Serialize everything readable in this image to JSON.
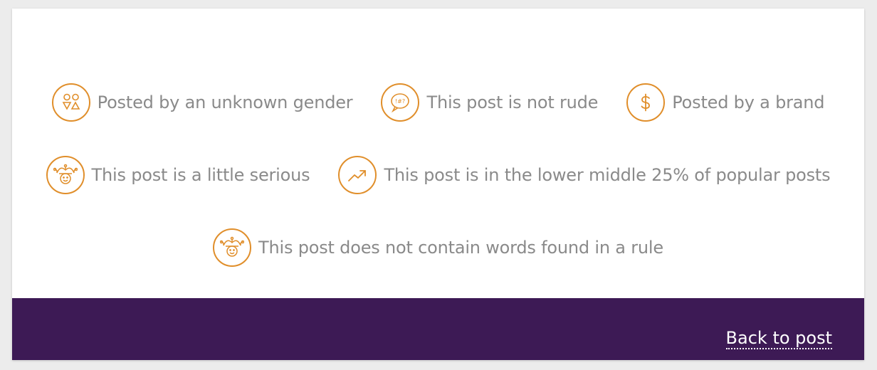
{
  "badges": {
    "gender": {
      "label": "Posted by an unknown gender",
      "icon": "gender-icon"
    },
    "rude": {
      "label": "This post is not rude",
      "icon": "speech-bubble-icon"
    },
    "brand": {
      "label": "Posted by a brand",
      "icon": "dollar-icon"
    },
    "serious": {
      "label": "This post is a little serious",
      "icon": "jester-icon"
    },
    "popular": {
      "label": "This post is in the lower middle 25% of popular posts",
      "icon": "trending-up-icon"
    },
    "rule": {
      "label": "This post does not contain words found in a rule",
      "icon": "jester-icon"
    }
  },
  "footer": {
    "back_label": "Back to post"
  },
  "colors": {
    "accent": "#e08e2a",
    "text": "#8a8a8a",
    "footer_bg": "#3d1a55",
    "card_bg": "#ffffff"
  }
}
